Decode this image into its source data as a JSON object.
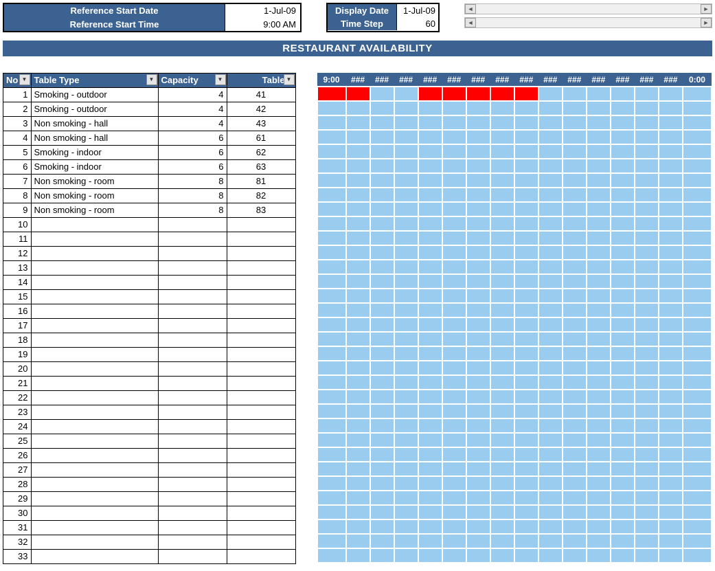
{
  "ref": {
    "start_date_label": "Reference Start Date",
    "start_date_value": "1-Jul-09",
    "start_time_label": "Reference Start Time",
    "start_time_value": "9:00 AM"
  },
  "disp": {
    "date_label": "Display Date",
    "date_value": "1-Jul-09",
    "step_label": "Time Step",
    "step_value": "60"
  },
  "title": "RESTAURANT AVAILABILITY",
  "columns": {
    "no": "No",
    "type": "Table Type",
    "cap": "Capacity",
    "num": "Table #"
  },
  "rows": [
    {
      "no": "1",
      "type": "Smoking - outdoor",
      "cap": "4",
      "num": "41"
    },
    {
      "no": "2",
      "type": "Smoking - outdoor",
      "cap": "4",
      "num": "42"
    },
    {
      "no": "3",
      "type": "Non smoking - hall",
      "cap": "4",
      "num": "43"
    },
    {
      "no": "4",
      "type": "Non smoking - hall",
      "cap": "6",
      "num": "61"
    },
    {
      "no": "5",
      "type": "Smoking - indoor",
      "cap": "6",
      "num": "62"
    },
    {
      "no": "6",
      "type": "Smoking - indoor",
      "cap": "6",
      "num": "63"
    },
    {
      "no": "7",
      "type": "Non smoking - room",
      "cap": "8",
      "num": "81"
    },
    {
      "no": "8",
      "type": "Non smoking - room",
      "cap": "8",
      "num": "82"
    },
    {
      "no": "9",
      "type": "Non smoking - room",
      "cap": "8",
      "num": "83"
    },
    {
      "no": "10",
      "type": "",
      "cap": "",
      "num": ""
    },
    {
      "no": "11",
      "type": "",
      "cap": "",
      "num": ""
    },
    {
      "no": "12",
      "type": "",
      "cap": "",
      "num": ""
    },
    {
      "no": "13",
      "type": "",
      "cap": "",
      "num": ""
    },
    {
      "no": "14",
      "type": "",
      "cap": "",
      "num": ""
    },
    {
      "no": "15",
      "type": "",
      "cap": "",
      "num": ""
    },
    {
      "no": "16",
      "type": "",
      "cap": "",
      "num": ""
    },
    {
      "no": "17",
      "type": "",
      "cap": "",
      "num": ""
    },
    {
      "no": "18",
      "type": "",
      "cap": "",
      "num": ""
    },
    {
      "no": "19",
      "type": "",
      "cap": "",
      "num": ""
    },
    {
      "no": "20",
      "type": "",
      "cap": "",
      "num": ""
    },
    {
      "no": "21",
      "type": "",
      "cap": "",
      "num": ""
    },
    {
      "no": "22",
      "type": "",
      "cap": "",
      "num": ""
    },
    {
      "no": "23",
      "type": "",
      "cap": "",
      "num": ""
    },
    {
      "no": "24",
      "type": "",
      "cap": "",
      "num": ""
    },
    {
      "no": "25",
      "type": "",
      "cap": "",
      "num": ""
    },
    {
      "no": "26",
      "type": "",
      "cap": "",
      "num": ""
    },
    {
      "no": "27",
      "type": "",
      "cap": "",
      "num": ""
    },
    {
      "no": "28",
      "type": "",
      "cap": "",
      "num": ""
    },
    {
      "no": "29",
      "type": "",
      "cap": "",
      "num": ""
    },
    {
      "no": "30",
      "type": "",
      "cap": "",
      "num": ""
    },
    {
      "no": "31",
      "type": "",
      "cap": "",
      "num": ""
    },
    {
      "no": "32",
      "type": "",
      "cap": "",
      "num": ""
    },
    {
      "no": "33",
      "type": "",
      "cap": "",
      "num": ""
    }
  ],
  "time_headers": [
    "9:00",
    "###",
    "###",
    "###",
    "###",
    "###",
    "###",
    "###",
    "###",
    "###",
    "###",
    "###",
    "###",
    "###",
    "###",
    "0:00"
  ],
  "busy_cells": [
    {
      "row": 0,
      "cols": [
        0,
        1,
        4,
        5,
        6,
        7,
        8
      ]
    }
  ],
  "grid_rows": 33
}
